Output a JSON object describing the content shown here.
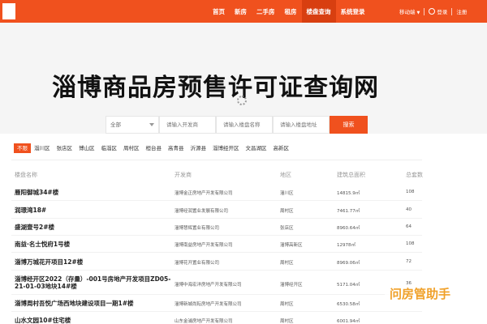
{
  "nav": {
    "items": [
      "首页",
      "新房",
      "二手房",
      "租房",
      "楼盘查询",
      "系统登录"
    ],
    "active_index": 4,
    "mobile": "移动端",
    "login": "登录",
    "register": "注册"
  },
  "page": {
    "title": "淄博商品房预售许可证查询网"
  },
  "search": {
    "select_value": "全部",
    "field1_placeholder": "请输入开发商",
    "field2_placeholder": "请输入楼盘名称",
    "field3_placeholder": "请输入楼盘地址",
    "button_label": "搜索"
  },
  "districts": {
    "items": [
      "不限",
      "淄川区",
      "张店区",
      "博山区",
      "临淄区",
      "周村区",
      "桓台县",
      "高青县",
      "沂源县",
      "淄博经开区",
      "文昌湖区",
      "高新区"
    ],
    "active_index": 0
  },
  "table": {
    "headers": [
      "楼盘名称",
      "开发商",
      "地区",
      "建筑总面积",
      "总套数"
    ],
    "rows": [
      {
        "name": "雁阳御城34#楼",
        "developer": "淄博金正房地产开发有限公司",
        "area": "淄川区",
        "size": "14815.9㎡",
        "count": "108"
      },
      {
        "name": "润璟湾18#",
        "developer": "淄博经润置业发展有限公司",
        "area": "周村区",
        "size": "7461.77㎡",
        "count": "40"
      },
      {
        "name": "盛湖壹号2#楼",
        "developer": "淄博慧辉置业有限公司",
        "area": "张店区",
        "size": "8960.64㎡",
        "count": "64"
      },
      {
        "name": "南益·名士悦府1号楼",
        "developer": "淄博南益房地产开发有限公司",
        "area": "淄博高新区",
        "size": "12978㎡",
        "count": "108"
      },
      {
        "name": "淄博万城花开项目12#楼",
        "developer": "淄博花开置业有限公司",
        "area": "周村区",
        "size": "8969.06㎡",
        "count": "72"
      },
      {
        "name": "淄博经开区2022（存量）-001号房地产开发项目ZD05-21-01-03地块14#楼",
        "name_line1": "淄博经开区2022（存量）-001号房地产开发项目ZD05-",
        "name_line2": "21-01-03地块14#楼",
        "developer": "淄博中海宏洋房地产开发有限公司",
        "area": "淄博经开区",
        "size": "5171.04㎡",
        "count": "36"
      },
      {
        "name": "淄博周村吾悦广场西地块建设项目一期1#楼",
        "developer": "淄博新城尚耘房地产开发有限公司",
        "area": "周村区",
        "size": "6530.58㎡",
        "count": ""
      },
      {
        "name": "山水文园10#住宅楼",
        "developer": "山东金浦房地产开发有限公司",
        "area": "周村区",
        "size": "6001.94㎡",
        "count": ""
      }
    ]
  },
  "watermark": "问房管助手",
  "colors": {
    "brand": "#f0511e",
    "watermark": "#f0a12a"
  }
}
